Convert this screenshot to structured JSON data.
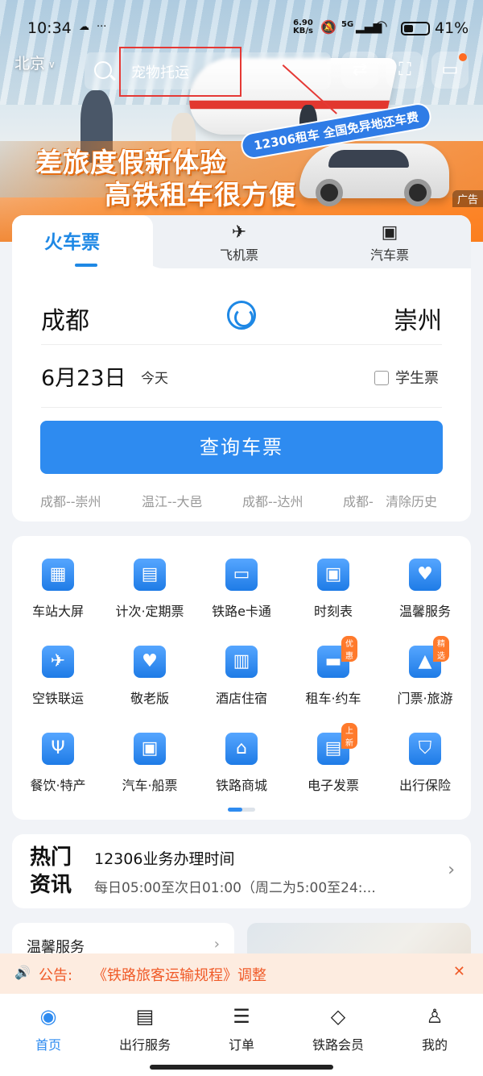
{
  "status_bar": {
    "time": "10:34",
    "net_speed_value": "6.90",
    "net_speed_unit": "KB/s",
    "network": "5G",
    "battery_pct": "41%",
    "battery_level": 0.41
  },
  "top_nav": {
    "city": "北京",
    "search_text": "宠物托运"
  },
  "banner": {
    "headline_1": "差旅度假新体验",
    "headline_2": "高铁租车很方便",
    "promo_tag": "12306租车 全国免异地还车费",
    "ad_label": "广告"
  },
  "ticket": {
    "tabs": [
      {
        "label": "火车票",
        "icon": "train-icon"
      },
      {
        "label": "飞机票",
        "icon": "plane-icon"
      },
      {
        "label": "汽车票",
        "icon": "bus-icon"
      }
    ],
    "from_station": "成都",
    "to_station": "崇州",
    "date": "6月23日",
    "date_sub": "今天",
    "student_label": "学生票",
    "query_label": "查询车票",
    "history": [
      "成都--崇州",
      "温江--大邑",
      "成都--达州",
      "成都-"
    ],
    "clear_history": "清除历史"
  },
  "services": [
    {
      "label": "车站大屏",
      "icon": "calendar-grid-icon"
    },
    {
      "label": "计次·定期票",
      "icon": "ticket-clock-icon"
    },
    {
      "label": "铁路e卡通",
      "icon": "ecard-icon"
    },
    {
      "label": "时刻表",
      "icon": "train-front-icon"
    },
    {
      "label": "温馨服务",
      "icon": "heart-bag-icon"
    },
    {
      "label": "空铁联运",
      "icon": "plane-train-icon"
    },
    {
      "label": "敬老版",
      "icon": "heart-icon"
    },
    {
      "label": "酒店住宿",
      "icon": "building-icon"
    },
    {
      "label": "租车·约车",
      "icon": "car-icon",
      "badge": "优惠"
    },
    {
      "label": "门票·旅游",
      "icon": "mountain-icon",
      "badge": "精选"
    },
    {
      "label": "餐饮·特产",
      "icon": "fork-knife-icon"
    },
    {
      "label": "汽车·船票",
      "icon": "bus-anchor-icon"
    },
    {
      "label": "铁路商城",
      "icon": "shop-icon"
    },
    {
      "label": "电子发票",
      "icon": "invoice-icon",
      "badge": "上新"
    },
    {
      "label": "出行保险",
      "icon": "shield-bao-icon"
    }
  ],
  "news": {
    "logo_line1": "热门",
    "logo_line2": "资讯",
    "title": "12306业务办理时间",
    "subtitle": "每日05:00至次日01:00（周二为5:00至24:..."
  },
  "warm_service": {
    "title": "温馨服务"
  },
  "notice": {
    "label": "公告:",
    "text": "《铁路旅客运输规程》调整"
  },
  "bottom_nav": [
    {
      "label": "首页",
      "icon": "home-train-icon",
      "active": true
    },
    {
      "label": "出行服务",
      "icon": "luggage-icon"
    },
    {
      "label": "订单",
      "icon": "order-icon"
    },
    {
      "label": "铁路会员",
      "icon": "diamond-icon"
    },
    {
      "label": "我的",
      "icon": "profile-icon"
    }
  ],
  "colors": {
    "accent": "#2e8bf0",
    "notice": "#f05a28",
    "badge": "#ff7a2c"
  }
}
